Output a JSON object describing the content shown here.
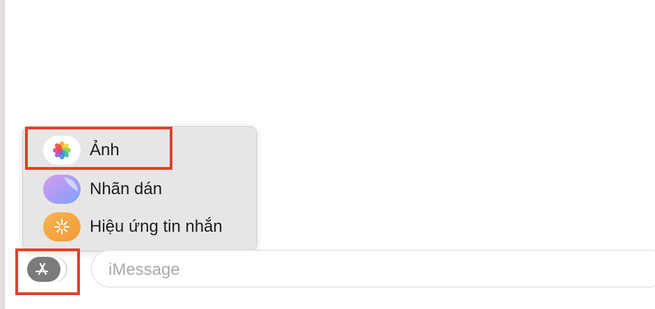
{
  "menu": {
    "items": [
      {
        "label": "Ảnh",
        "icon": "photos-icon"
      },
      {
        "label": "Nhãn dán",
        "icon": "stickers-icon"
      },
      {
        "label": "Hiệu ứng tin nhắn",
        "icon": "message-effects-icon"
      }
    ]
  },
  "input": {
    "placeholder": "iMessage",
    "value": ""
  },
  "apps_button": {
    "icon": "app-store-icon"
  },
  "colors": {
    "highlight": "#e2402c",
    "popup_bg": "#e8e6e5",
    "apps_button": "#7c7b7b",
    "placeholder": "#a9a9a9"
  }
}
